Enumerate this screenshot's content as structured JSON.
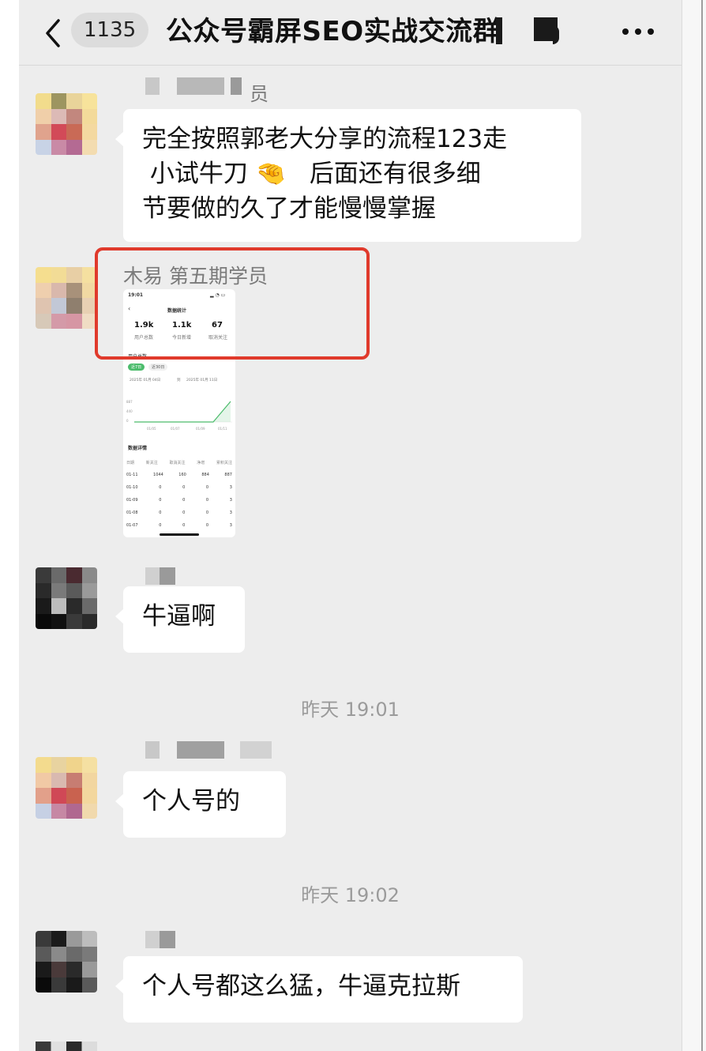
{
  "nav": {
    "unread_count": "1135",
    "title": "公众号霸屏SEO实战交流群"
  },
  "messages": [
    {
      "sender": "员",
      "lines": [
        "完全按照郭老大分享的流程123走",
        " 小试牛刀 🤏   后面还有很多细",
        "节要做的久了才能慢慢掌握"
      ]
    },
    {
      "sender": "木易  第五期学员",
      "image": {
        "status_time": "19:01",
        "page_title": "数据统计",
        "stats": [
          {
            "value": "1.9k",
            "label": "用户总数"
          },
          {
            "value": "1.1k",
            "label": "今日新增"
          },
          {
            "value": "67",
            "label": "取消关注"
          }
        ],
        "chart_section": "用户总数",
        "range_tags": [
          "近7日",
          "近30日"
        ],
        "date_range": {
          "start": "2025年 01月 04日",
          "sep": "到",
          "end": "2025年 01月 11日"
        },
        "y_ticks": [
          "887",
          "440",
          "0"
        ],
        "x_ticks": [
          "01/05",
          "01/07",
          "01/09",
          "01/11"
        ],
        "table_title": "数据详情",
        "table_headers": [
          "日期",
          "新关注",
          "取消关注",
          "净增",
          "累积关注"
        ],
        "table_rows": [
          [
            "01-11",
            "1044",
            "160",
            "884",
            "887"
          ],
          [
            "01-10",
            "0",
            "0",
            "0",
            "3"
          ],
          [
            "01-09",
            "0",
            "0",
            "0",
            "3"
          ],
          [
            "01-08",
            "0",
            "0",
            "0",
            "3"
          ],
          [
            "01-07",
            "0",
            "0",
            "0",
            "3"
          ]
        ]
      }
    },
    {
      "sender": "",
      "lines": [
        "牛逼啊"
      ]
    },
    {
      "sender": "",
      "lines": [
        "个人号的"
      ]
    },
    {
      "sender": "",
      "lines": [
        "个人号都这么猛，牛逼克拉斯"
      ]
    }
  ],
  "timestamps": [
    "昨天 19:01",
    "昨天 19:02"
  ]
}
